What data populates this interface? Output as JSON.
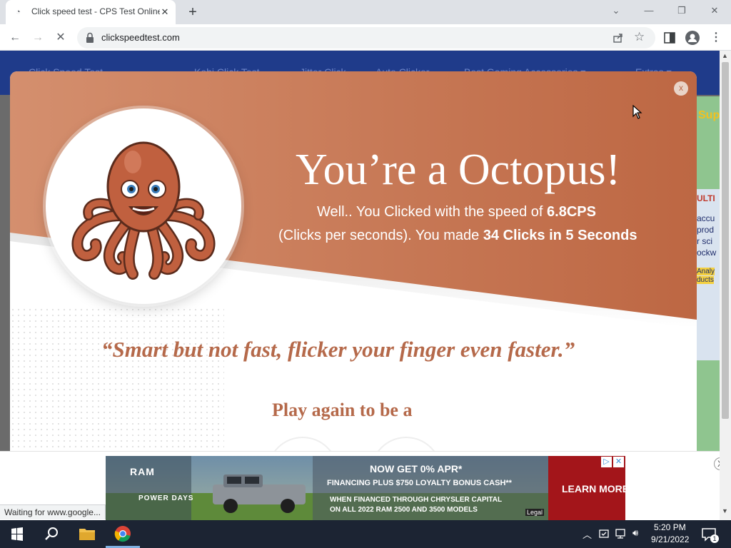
{
  "browser": {
    "tab_title": "Click speed test - CPS Test Online",
    "new_tab_symbol": "+",
    "url": "clickspeedtest.com",
    "status_text": "Waiting for www.google..."
  },
  "site_nav": {
    "items": [
      "Click Speed Test",
      "Kohi Click Test",
      "Jitter Click",
      "Auto Clicker",
      "Best Gaming Accessories ▾",
      "Extras ▾"
    ]
  },
  "side_ad": {
    "badge": "Sup",
    "lines": [
      "ULTI",
      "accu",
      "prod",
      "r sci",
      "ockw",
      "Analy",
      "ducts"
    ]
  },
  "result_modal": {
    "close_label": "x",
    "headline": "You’re a Octopus!",
    "speed_prefix": "Well.. You Clicked with the speed of ",
    "speed_value": "6.8CPS",
    "clicks_prefix": "(Clicks per seconds). You made ",
    "clicks_value": "34 Clicks in 5 Seconds",
    "quote": "“Smart but not fast, flicker your finger even faster.”",
    "play_again": "Play again to be a",
    "accent_color": "#c2704f"
  },
  "bottom_ad": {
    "brand": "RAM",
    "event": "POWER DAYS",
    "offer_title": "NOW GET 0% APR*",
    "offer_line2": "FINANCING PLUS $750 LOYALTY BONUS CASH**",
    "offer_line3": "WHEN FINANCED THROUGH CHRYSLER CAPITAL",
    "offer_line4": "ON ALL 2022 RAM 2500 AND 3500 MODELS",
    "cta": "LEARN MORE",
    "legal": "Legal",
    "close_label": "X"
  },
  "taskbar": {
    "time": "5:20 PM",
    "date": "9/21/2022",
    "notification_count": "1"
  }
}
